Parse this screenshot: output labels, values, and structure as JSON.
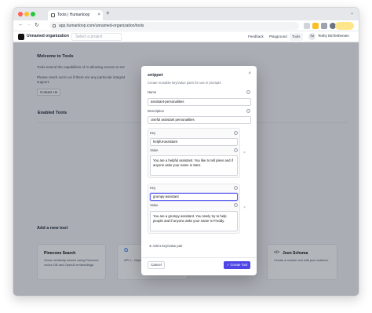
{
  "browser": {
    "tab_title": "Tools | Humanloop",
    "url": "app.humanloop.com/unnamed-organization/tools"
  },
  "header": {
    "org_name": "Unnamed organization",
    "project_placeholder": "Select a project",
    "nav": [
      "Feedback",
      "Playground",
      "Tools"
    ],
    "active_nav": "Tools",
    "avatar_initials": "TM",
    "user_name": "Teshy McTeshersen"
  },
  "page": {
    "welcome_title": "Welcome to Tools",
    "welcome_text_1": "Tools extend the capabilities of AI allowing access to ext",
    "welcome_text_2": "Please reach out to us if there are any particular integrat",
    "welcome_text_3": "support.",
    "contact_label": "Contact Us",
    "enabled_title": "Enabled Tools",
    "add_title": "Add a new tool",
    "cards": [
      {
        "title": "Pinecone Search",
        "desc": "Vector similarity search using Pinecone vector DB and OpenAI embeddings."
      },
      {
        "title": "",
        "desc": "API f... https:..."
      },
      {
        "title": "Json Schema",
        "desc": "Create a custom tool with json schema."
      }
    ]
  },
  "modal": {
    "title": "snippet",
    "subtitle": "Create reusable key/value pairs for use in prompts",
    "name_label": "Name",
    "name_value": "assistant-personalities",
    "description_label": "Description",
    "description_value": "Useful assistant personalities",
    "pairs": [
      {
        "key_label": "Key",
        "key_value": "helpful-assistant",
        "value_label": "Value",
        "value_text": "You are a helpful assistant. You like to tell jokes and if anyone asks your name is Sam."
      },
      {
        "key_label": "Key",
        "key_value": "grumpy-assistant",
        "value_label": "Value",
        "value_text": "You are a grumpy assistant. You rarely try to help people and if anyone asks your name is Freddy."
      }
    ],
    "add_pair_label": "Add a key/value pair",
    "cancel_label": "Cancel",
    "create_label": "Create Tool"
  },
  "colors": {
    "accent": "#4f46e5",
    "focus": "#6366f1"
  }
}
